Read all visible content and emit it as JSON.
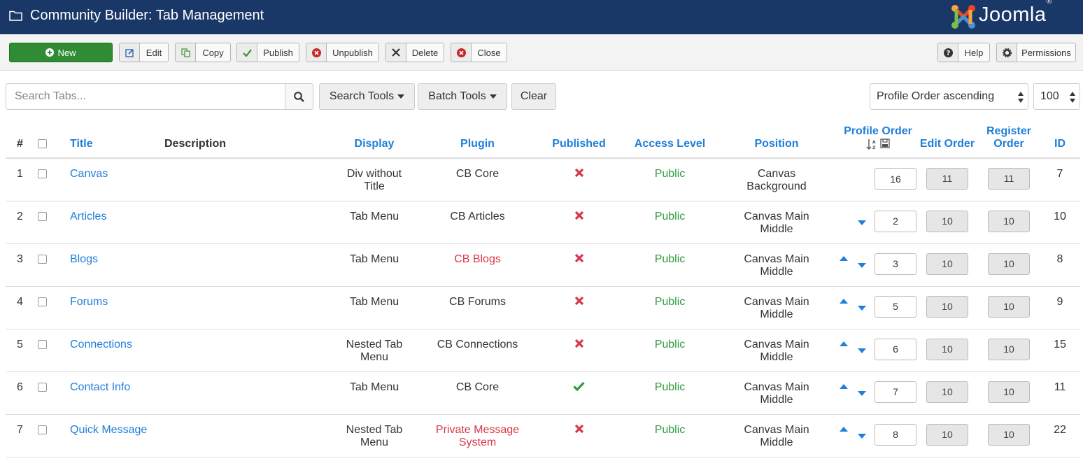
{
  "header": {
    "title": "Community Builder: Tab Management",
    "logo_text": "Joomla!"
  },
  "toolbar": {
    "new": "New",
    "edit": "Edit",
    "copy": "Copy",
    "publish": "Publish",
    "unpublish": "Unpublish",
    "delete": "Delete",
    "close": "Close",
    "help": "Help",
    "permissions": "Permissions"
  },
  "filters": {
    "search_placeholder": "Search Tabs...",
    "search_tools": "Search Tools",
    "batch_tools": "Batch Tools",
    "clear": "Clear",
    "ordering": "Profile Order ascending",
    "limit": "100"
  },
  "columns": {
    "num": "#",
    "title": "Title",
    "description": "Description",
    "display": "Display",
    "plugin": "Plugin",
    "published": "Published",
    "access": "Access Level",
    "position": "Position",
    "profile_order": "Profile Order",
    "edit_order": "Edit Order",
    "register_order": "Register Order",
    "id": "ID"
  },
  "rows": [
    {
      "num": "1",
      "title": "Canvas",
      "display": "Div without Title",
      "plugin": "CB Core",
      "plugin_red": false,
      "published": false,
      "access": "Public",
      "position": "Canvas Background",
      "up": false,
      "down": false,
      "profile_order": "16",
      "edit_order": "11",
      "register_order": "11",
      "id": "7"
    },
    {
      "num": "2",
      "title": "Articles",
      "display": "Tab Menu",
      "plugin": "CB Articles",
      "plugin_red": false,
      "published": false,
      "access": "Public",
      "position": "Canvas Main Middle",
      "up": false,
      "down": true,
      "profile_order": "2",
      "edit_order": "10",
      "register_order": "10",
      "id": "10"
    },
    {
      "num": "3",
      "title": "Blogs",
      "display": "Tab Menu",
      "plugin": "CB Blogs",
      "plugin_red": true,
      "published": false,
      "access": "Public",
      "position": "Canvas Main Middle",
      "up": true,
      "down": true,
      "profile_order": "3",
      "edit_order": "10",
      "register_order": "10",
      "id": "8"
    },
    {
      "num": "4",
      "title": "Forums",
      "display": "Tab Menu",
      "plugin": "CB Forums",
      "plugin_red": false,
      "published": false,
      "access": "Public",
      "position": "Canvas Main Middle",
      "up": true,
      "down": true,
      "profile_order": "5",
      "edit_order": "10",
      "register_order": "10",
      "id": "9"
    },
    {
      "num": "5",
      "title": "Connections",
      "display": "Nested Tab Menu",
      "plugin": "CB Connections",
      "plugin_red": false,
      "published": false,
      "access": "Public",
      "position": "Canvas Main Middle",
      "up": true,
      "down": true,
      "profile_order": "6",
      "edit_order": "10",
      "register_order": "10",
      "id": "15"
    },
    {
      "num": "6",
      "title": "Contact Info",
      "display": "Tab Menu",
      "plugin": "CB Core",
      "plugin_red": false,
      "published": true,
      "access": "Public",
      "position": "Canvas Main Middle",
      "up": true,
      "down": true,
      "profile_order": "7",
      "edit_order": "10",
      "register_order": "10",
      "id": "11"
    },
    {
      "num": "7",
      "title": "Quick Message",
      "display": "Nested Tab Menu",
      "plugin": "Private Message System",
      "plugin_red": true,
      "published": false,
      "access": "Public",
      "position": "Canvas Main Middle",
      "up": true,
      "down": true,
      "profile_order": "8",
      "edit_order": "10",
      "register_order": "10",
      "id": "22"
    }
  ],
  "colors": {
    "header_bg": "#1a3867",
    "link": "#1f7fd9",
    "green": "#2f9a3a",
    "red": "#d9364a",
    "new_btn": "#2f8b34"
  }
}
